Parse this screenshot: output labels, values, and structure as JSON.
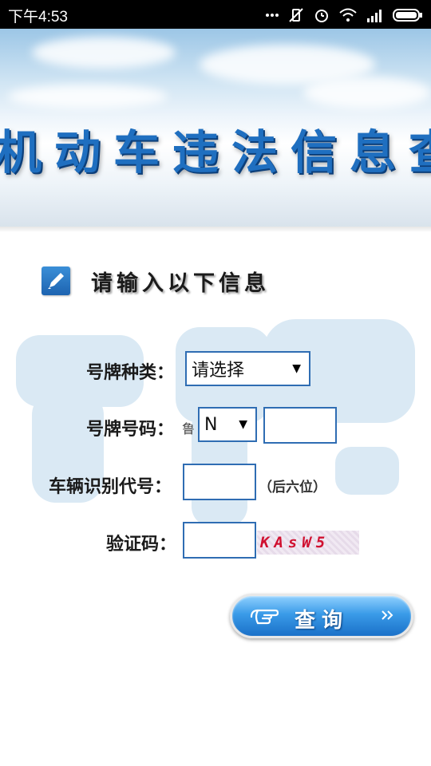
{
  "status_bar": {
    "time": "下午4:53",
    "icons": [
      "more-dots-icon",
      "vibrate-off-icon",
      "alarm-icon",
      "wifi-icon",
      "signal-icon",
      "battery-icon"
    ]
  },
  "banner": {
    "title": "机动车违法信息查"
  },
  "section": {
    "title": "请输入以下信息"
  },
  "form": {
    "plate_type": {
      "label": "号牌种类：",
      "value": "请选择"
    },
    "plate_number": {
      "label": "号牌号码：",
      "prefix": "鲁",
      "letter": "N",
      "value": ""
    },
    "vin": {
      "label": "车辆识别代号：",
      "value": "",
      "hint": "（后六位）"
    },
    "captcha": {
      "label": "验证码：",
      "value": "",
      "code": "KAsW5"
    }
  },
  "query_button": {
    "label": "查询"
  },
  "colors": {
    "accent": "#2f6db3",
    "captcha_text": "#d01030",
    "title_blue": "#1f6fc0"
  }
}
